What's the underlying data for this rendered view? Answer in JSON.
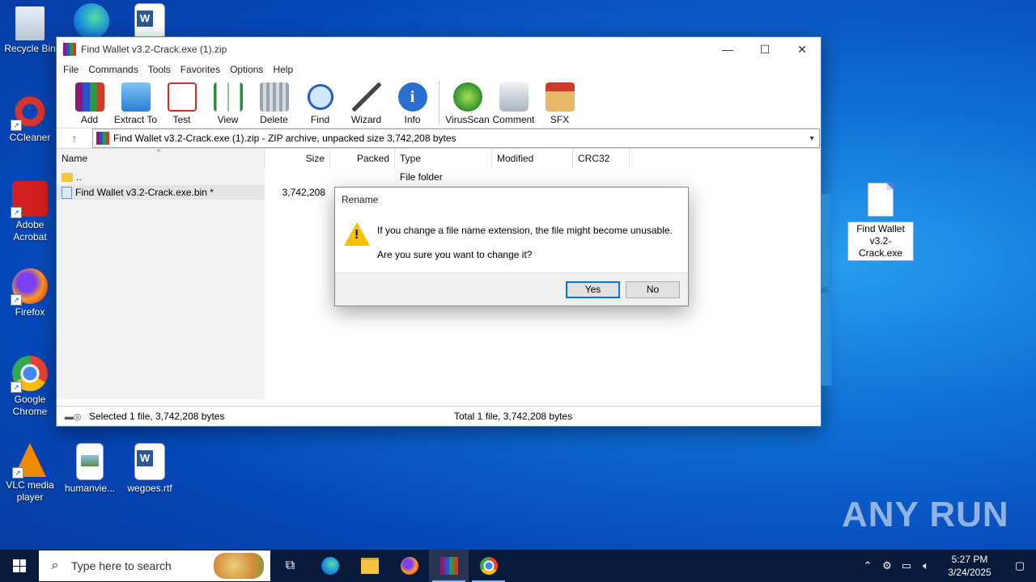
{
  "desktop": {
    "icons": [
      {
        "label": "Recycle Bin"
      },
      {
        "label": "CCleaner"
      },
      {
        "label": "Adobe Acrobat"
      },
      {
        "label": "Firefox"
      },
      {
        "label": "Google Chrome"
      },
      {
        "label": "VLC media player"
      },
      {
        "label": "humanvie..."
      },
      {
        "label": "wegoes.rtf"
      }
    ],
    "selected_file_label": "Find Wallet v3.2-Crack.exe",
    "watermark": "ANY RUN"
  },
  "winrar": {
    "title": "Find Wallet v3.2-Crack.exe (1).zip",
    "window_controls": {
      "minimize": "—",
      "maximize": "☐",
      "close": "✕"
    },
    "menu": [
      "File",
      "Commands",
      "Tools",
      "Favorites",
      "Options",
      "Help"
    ],
    "toolbar": [
      {
        "label": "Add",
        "icon": "add-icon"
      },
      {
        "label": "Extract To",
        "icon": "extract-icon"
      },
      {
        "label": "Test",
        "icon": "test-icon"
      },
      {
        "label": "View",
        "icon": "view-icon"
      },
      {
        "label": "Delete",
        "icon": "delete-icon"
      },
      {
        "label": "Find",
        "icon": "find-icon"
      },
      {
        "label": "Wizard",
        "icon": "wizard-icon"
      },
      {
        "label": "Info",
        "icon": "info-icon"
      },
      {
        "label": "VirusScan",
        "icon": "virusscan-icon"
      },
      {
        "label": "Comment",
        "icon": "comment-icon"
      },
      {
        "label": "SFX",
        "icon": "sfx-icon"
      }
    ],
    "address": "Find Wallet v3.2-Crack.exe (1).zip - ZIP archive, unpacked size 3,742,208 bytes",
    "columns": [
      "Name",
      "Size",
      "Packed",
      "Type",
      "Modified",
      "CRC32"
    ],
    "rows": [
      {
        "name": "..",
        "size": "",
        "packed": "",
        "type": "File folder",
        "modified": "",
        "crc": ""
      },
      {
        "name": "Find Wallet v3.2-Crack.exe.bin *",
        "size": "3,742,208",
        "packed": "",
        "type": "",
        "modified": "",
        "crc": ""
      }
    ],
    "status_left": "Selected 1 file, 3,742,208 bytes",
    "status_right": "Total 1 file, 3,742,208 bytes"
  },
  "dialog": {
    "title": "Rename",
    "message1": "If you change a file name extension, the file might become unusable.",
    "message2": "Are you sure you want to change it?",
    "yes_label": "Yes",
    "no_label": "No"
  },
  "taskbar": {
    "search_placeholder": "Type here to search",
    "time": "5:27 PM",
    "date": "3/24/2025"
  },
  "colors": {
    "desktop_bg": "#0647b8",
    "taskbar_bg": "#0a1a3a",
    "dialog_default_border": "#0078d7",
    "warning_yellow": "#f6c100"
  }
}
